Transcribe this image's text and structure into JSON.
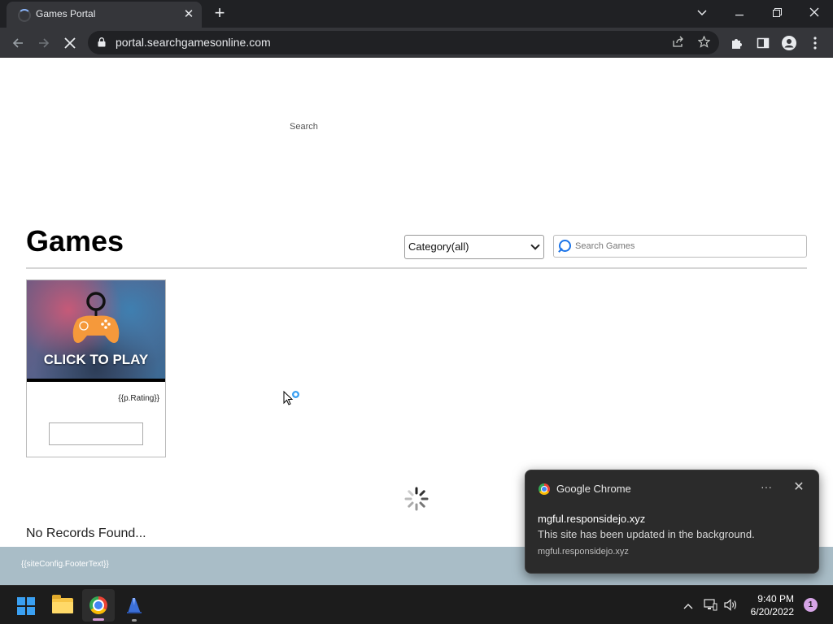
{
  "browser": {
    "tab_title": "Games Portal",
    "url": "portal.searchgamesonline.com"
  },
  "page": {
    "search_link": "Search",
    "heading": "Games",
    "category_select": {
      "selected": "Category(all)"
    },
    "search_games": {
      "placeholder": "Search Games"
    },
    "game_card": {
      "thumbnail_text": "CLICK TO PLAY",
      "rating_placeholder": "{{p.Rating}}"
    },
    "status_text": "No Records Found...",
    "footer_text": "{{siteConfig.FooterText}}"
  },
  "notification": {
    "app_name": "Google Chrome",
    "title": "mgful.responsidejo.xyz",
    "body": "This site has been updated in the background.",
    "source": "mgful.responsidejo.xyz"
  },
  "taskbar": {
    "clock_time": "9:40 PM",
    "clock_date": "6/20/2022",
    "notification_count": "1"
  },
  "colors": {
    "footer_bg": "#a9bdc7",
    "taskbar_bg": "#1c1c1c",
    "chrome_frame": "#202124",
    "accent_blue": "#1a73e8"
  }
}
